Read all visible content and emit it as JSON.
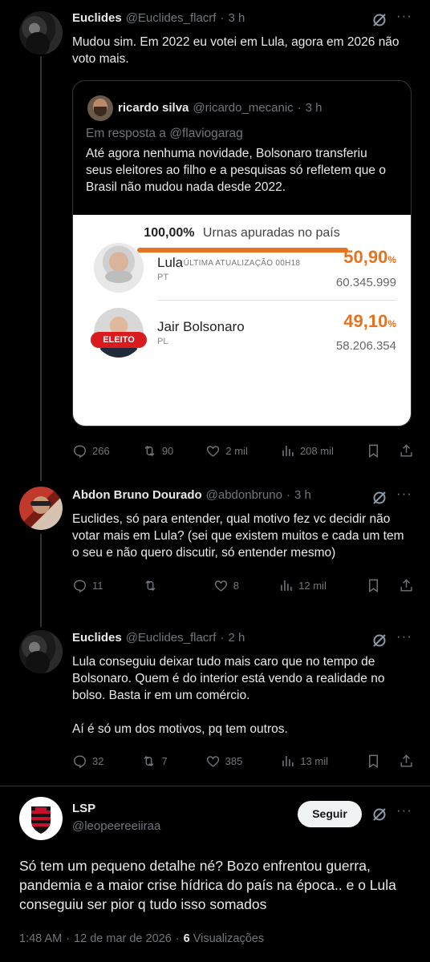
{
  "tweets": [
    {
      "author_name": "Euclides",
      "handle": "@Euclides_flacrf",
      "time": "3 h",
      "text_lines": [
        "Mudou sim. Em 2022 eu votei em Lula, agora em 2026 não",
        "voto mais."
      ],
      "stats": {
        "replies": "266",
        "retweets": "90",
        "likes": "2 mil",
        "views": "208 mil"
      }
    },
    {
      "author_name": "Abdon Bruno Dourado",
      "handle": "@abdonbruno",
      "time": "3 h",
      "text_lines": [
        "Euclides, só para entender, qual motivo fez vc decidir não",
        "votar mais em Lula? (sei que existem muitos e cada um tem",
        "o seu e não quero discutir, só entender mesmo)"
      ],
      "stats": {
        "replies": "11",
        "retweets": "",
        "likes": "8",
        "views": "12 mil"
      }
    },
    {
      "author_name": "Euclides",
      "handle": "@Euclides_flacrf",
      "time": "2 h",
      "text_lines": [
        "Lula conseguiu deixar tudo mais caro que no tempo de",
        "Bolsonaro. Quem é do interior está vendo a realidade no",
        "bolso. Basta ir em um comércio.",
        "",
        "Aí é só um dos motivos, pq tem outros."
      ],
      "stats": {
        "replies": "32",
        "retweets": "7",
        "likes": "385",
        "views": "13 mil"
      }
    }
  ],
  "quote": {
    "author_name": "ricardo silva",
    "handle": "@ricardo_mecanic",
    "time": "3 h",
    "reply_to": "Em resposta a @flaviogarag",
    "text_lines": [
      "Até  agora nenhuma novidade,  Bolsonaro transferiu",
      "seus eleitores ao filho e a pesquisas só  refletem que o",
      "Brasil não  mudou  nada desde  2022."
    ],
    "card": {
      "percent_counted": "100,00%",
      "counted_label": "Urnas apuradas no país",
      "counted_fraction": 1.0,
      "update_label": "ÚLTIMA ATUALIZAÇÃO 00H18",
      "candidates": [
        {
          "name": "Lula",
          "party": "PT",
          "percent": "50,90",
          "votes": "60.345.999",
          "badge": "ELEITO"
        },
        {
          "name": "Jair Bolsonaro",
          "party": "PL",
          "percent": "49,10",
          "votes": "58.206.354",
          "badge": ""
        }
      ],
      "percent_sign": "%",
      "accent_color": "#e5731f"
    }
  },
  "main_post": {
    "author_name": "LSP",
    "handle": "@leopeereeiiraa",
    "follow_label": "Seguir",
    "text_lines": [
      "Só tem um pequeno detalhe né? Bozo enfrentou guerra,",
      "pandemia e a maior crise hídrica do país na época.. e o Lula",
      "conseguiu ser pior q tudo isso somados"
    ],
    "timestamp": "1:48 AM",
    "date": "12 de mar de 2026",
    "views_count": "6",
    "views_label": "Visualizações"
  },
  "icons": [
    "grok-icon",
    "more-icon",
    "reply-icon",
    "retweet-icon",
    "like-icon",
    "views-icon",
    "bookmark-icon",
    "share-icon"
  ]
}
